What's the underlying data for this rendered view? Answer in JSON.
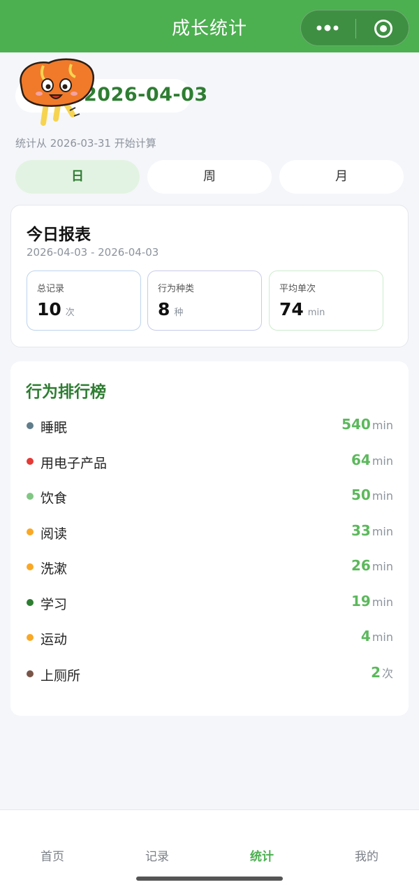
{
  "header": {
    "title": "成长统计"
  },
  "date": {
    "current": "2026-04-03"
  },
  "since_text": "统计从 2026-03-31 开始计算",
  "segments": [
    {
      "label": "日",
      "active": true
    },
    {
      "label": "周",
      "active": false
    },
    {
      "label": "月",
      "active": false
    }
  ],
  "report": {
    "title": "今日报表",
    "range": "2026-04-03 - 2026-04-03",
    "stats": [
      {
        "label": "总记录",
        "value": "10",
        "unit": "次"
      },
      {
        "label": "行为种类",
        "value": "8",
        "unit": "种"
      },
      {
        "label": "平均单次",
        "value": "74",
        "unit": "min"
      }
    ]
  },
  "ranking": {
    "title": "行为排行榜",
    "items": [
      {
        "name": "睡眠",
        "value": "540",
        "unit": "min",
        "color": "#607d8b"
      },
      {
        "name": "用电子产品",
        "value": "64",
        "unit": "min",
        "color": "#e53935"
      },
      {
        "name": "饮食",
        "value": "50",
        "unit": "min",
        "color": "#81c784"
      },
      {
        "name": "阅读",
        "value": "33",
        "unit": "min",
        "color": "#f9a825"
      },
      {
        "name": "洗漱",
        "value": "26",
        "unit": "min",
        "color": "#f9a825"
      },
      {
        "name": "学习",
        "value": "19",
        "unit": "min",
        "color": "#2e7d32"
      },
      {
        "name": "运动",
        "value": "4",
        "unit": "min",
        "color": "#f9a825"
      },
      {
        "name": "上厕所",
        "value": "2",
        "unit": "次",
        "color": "#795548"
      }
    ]
  },
  "tabbar": {
    "items": [
      {
        "label": "首页",
        "active": false
      },
      {
        "label": "记录",
        "active": false
      },
      {
        "label": "统计",
        "active": true
      },
      {
        "label": "我的",
        "active": false
      }
    ]
  },
  "colors": {
    "accent": "#4caf50",
    "accent_dark": "#2e7d32"
  }
}
